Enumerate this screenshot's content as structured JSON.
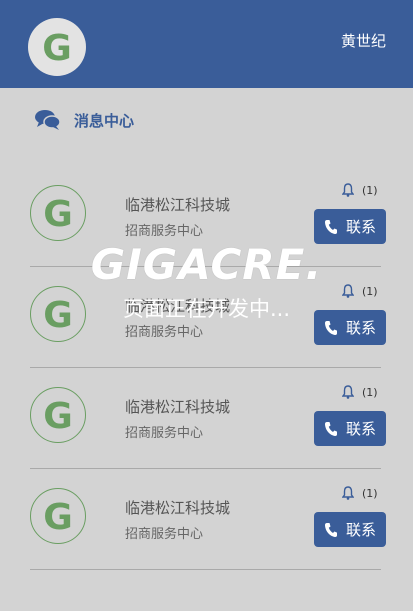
{
  "header": {
    "user_name": "黄世纪",
    "logo_letter": "G"
  },
  "section": {
    "title": "消息中心"
  },
  "messages": [
    {
      "avatar_letter": "G",
      "name": "临港松江科技城",
      "subtitle": "招商服务中心",
      "count": "(1)",
      "contact_label": "联系"
    },
    {
      "avatar_letter": "G",
      "name": "临港松江科技城",
      "subtitle": "招商服务中心",
      "count": "(1)",
      "contact_label": "联系"
    },
    {
      "avatar_letter": "G",
      "name": "临港松江科技城",
      "subtitle": "招商服务中心",
      "count": "(1)",
      "contact_label": "联系"
    },
    {
      "avatar_letter": "G",
      "name": "临港松江科技城",
      "subtitle": "招商服务中心",
      "count": "(1)",
      "contact_label": "联系"
    }
  ],
  "overlay": {
    "brand": "GIGACRE.",
    "message": "页面正在开发中..."
  },
  "colors": {
    "primary": "#3a5d99",
    "logo_green": "#6a9e62",
    "background": "#d3d3d3"
  },
  "icons": {
    "chat": "chat-bubbles-icon",
    "bell": "bell-icon",
    "phone": "phone-icon"
  }
}
